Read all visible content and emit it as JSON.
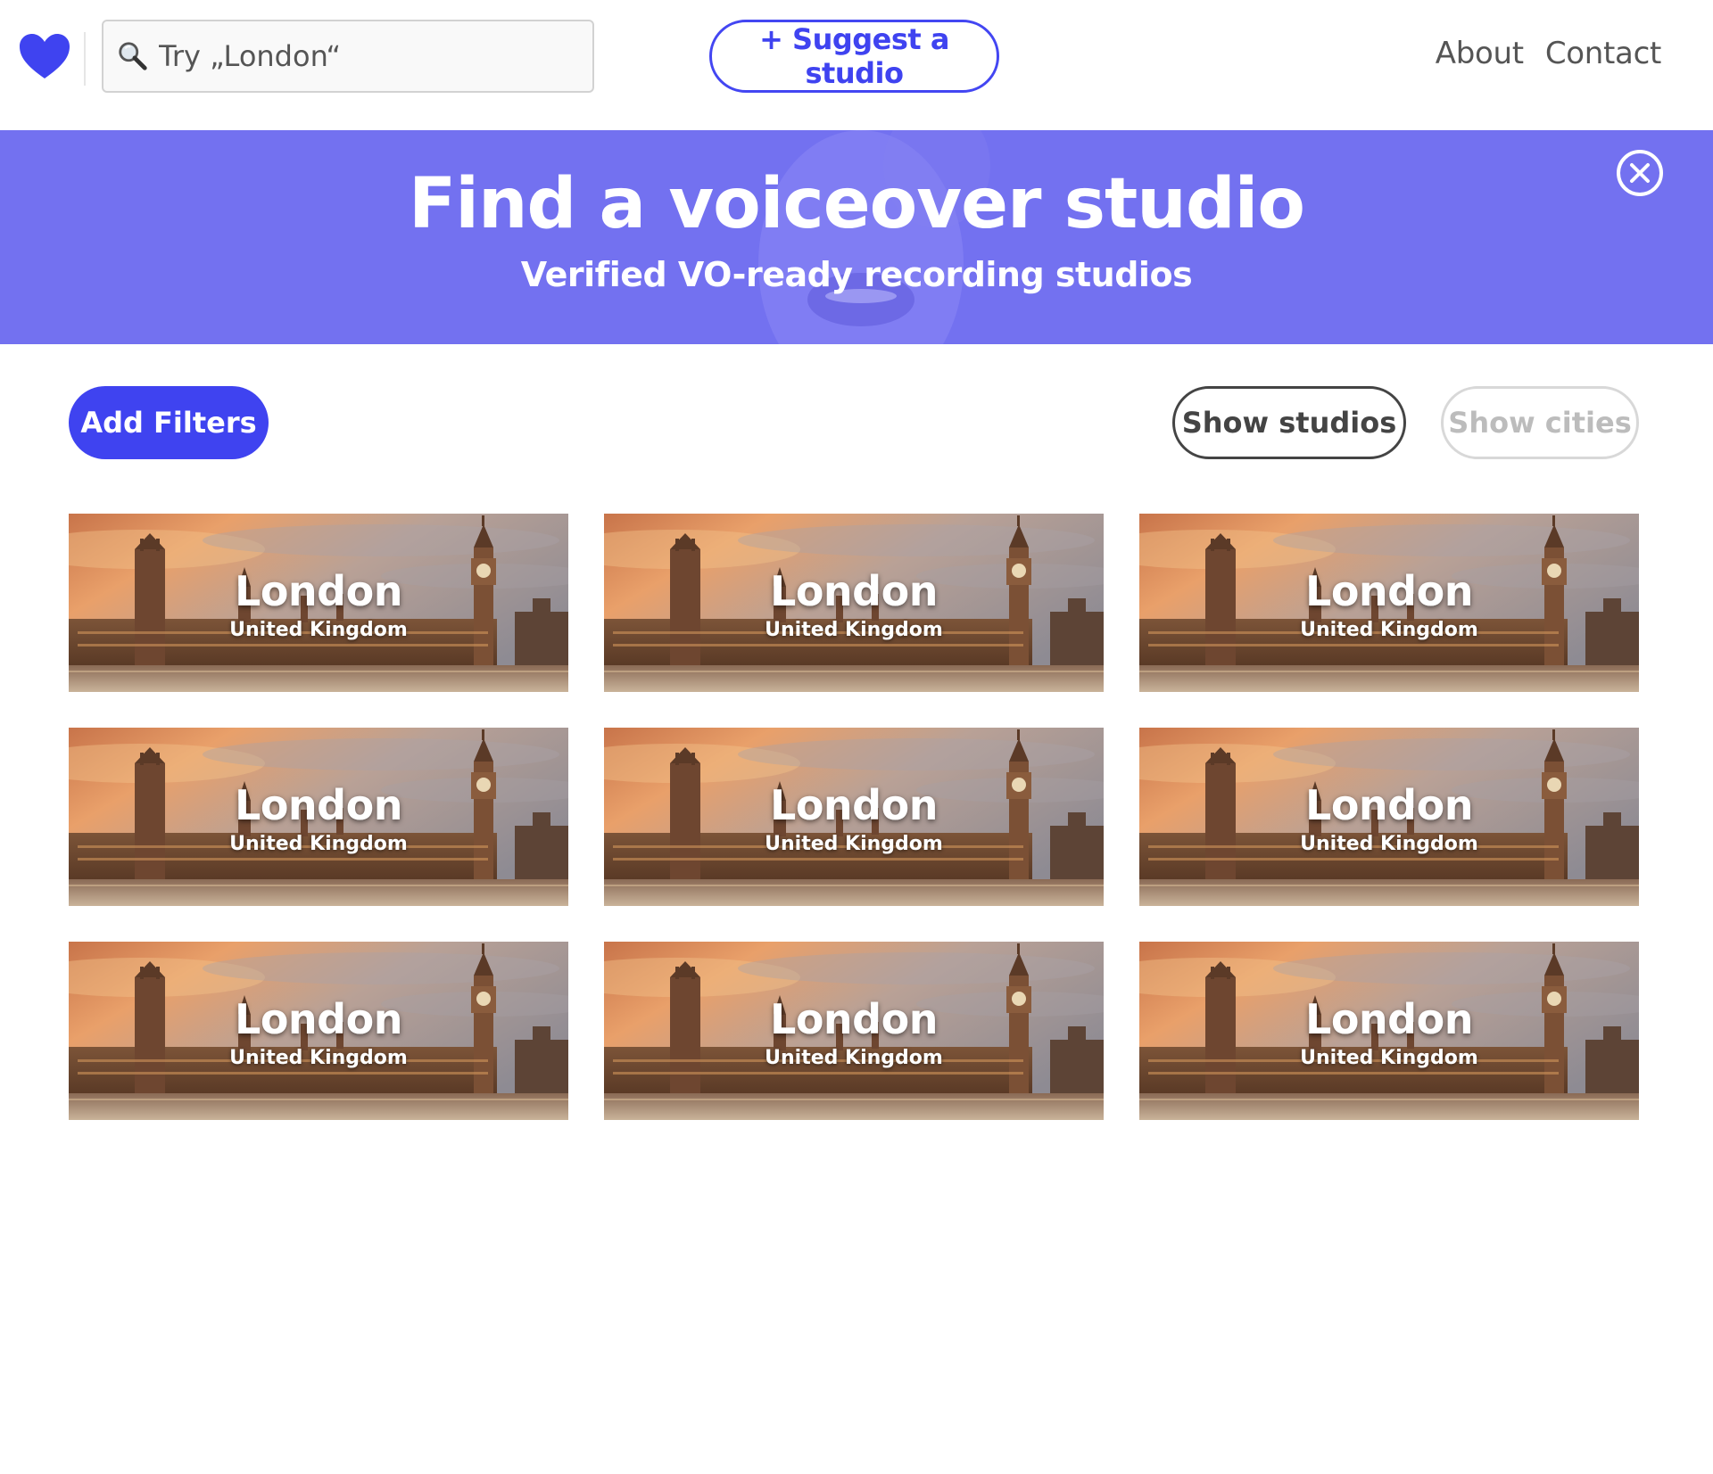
{
  "header": {
    "search": {
      "placeholder": "Try „London“"
    },
    "suggest_label": "+ Suggest a studio",
    "nav": [
      {
        "label": "About"
      },
      {
        "label": "Contact"
      }
    ]
  },
  "hero": {
    "title": "Find a voiceover studio",
    "subtitle": "Verified VO-ready recording studios"
  },
  "toolbar": {
    "filters_label": "Add Filters",
    "show_studios_label": "Show studios",
    "show_cities_label": "Show cities"
  },
  "cards": [
    {
      "city": "London",
      "country": "United Kingdom"
    },
    {
      "city": "London",
      "country": "United Kingdom"
    },
    {
      "city": "London",
      "country": "United Kingdom"
    },
    {
      "city": "London",
      "country": "United Kingdom"
    },
    {
      "city": "London",
      "country": "United Kingdom"
    },
    {
      "city": "London",
      "country": "United Kingdom"
    },
    {
      "city": "London",
      "country": "United Kingdom"
    },
    {
      "city": "London",
      "country": "United Kingdom"
    },
    {
      "city": "London",
      "country": "United Kingdom"
    }
  ],
  "colors": {
    "brand": "#3f43f0",
    "hero_background": "#7371f0",
    "text": "#444444",
    "disabled_text": "#bcbcbc"
  }
}
